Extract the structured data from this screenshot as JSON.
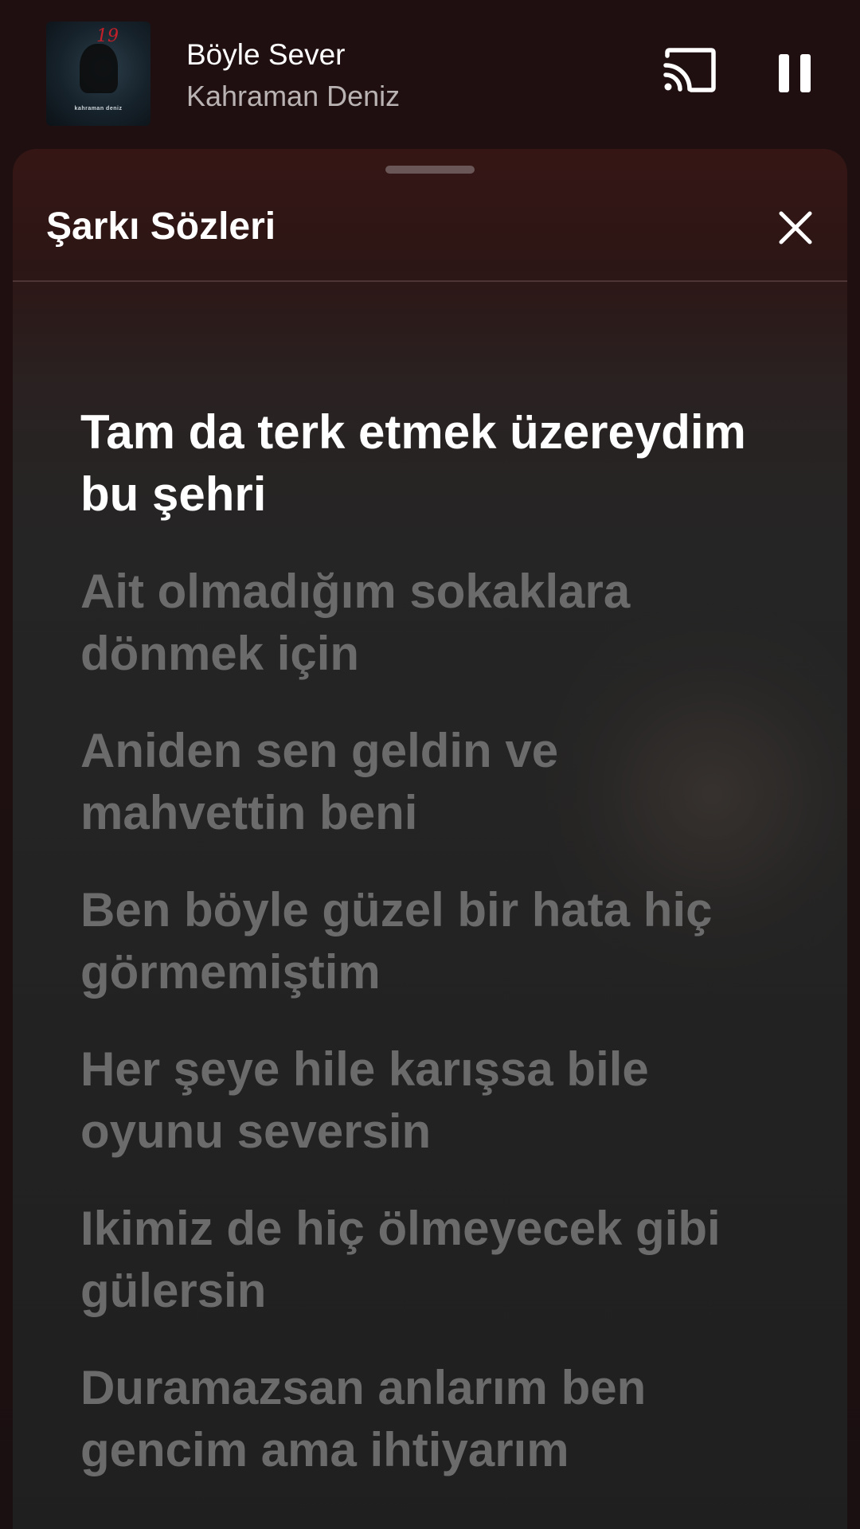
{
  "now_playing": {
    "title": "Böyle Sever",
    "artist": "Kahraman Deniz",
    "album_art": {
      "number": "19",
      "caption": "kahraman deniz"
    }
  },
  "controls": {
    "cast_icon": "cast-icon",
    "pause_icon": "pause-icon"
  },
  "lyrics_sheet": {
    "title": "Şarkı Sözleri",
    "close_icon": "close-icon",
    "active_index": 0,
    "lines": [
      "Tam da terk etmek üzereydim bu şehri",
      "Ait olmadığım sokaklara dönmek için",
      "Aniden sen geldin ve mahvettin beni",
      "Ben böyle güzel bir hata hiç görmemiştim",
      "Her şeye hile karışsa bile oyunu seversin",
      "Ikimiz de hiç ölmeyecek gibi gülersin",
      "Duramazsan anlarım ben gencim ama ihtiyarım"
    ]
  },
  "colors": {
    "active_lyric": "#ffffff",
    "inactive_lyric": "#6b6b6b",
    "sheet_header": "#351615"
  }
}
